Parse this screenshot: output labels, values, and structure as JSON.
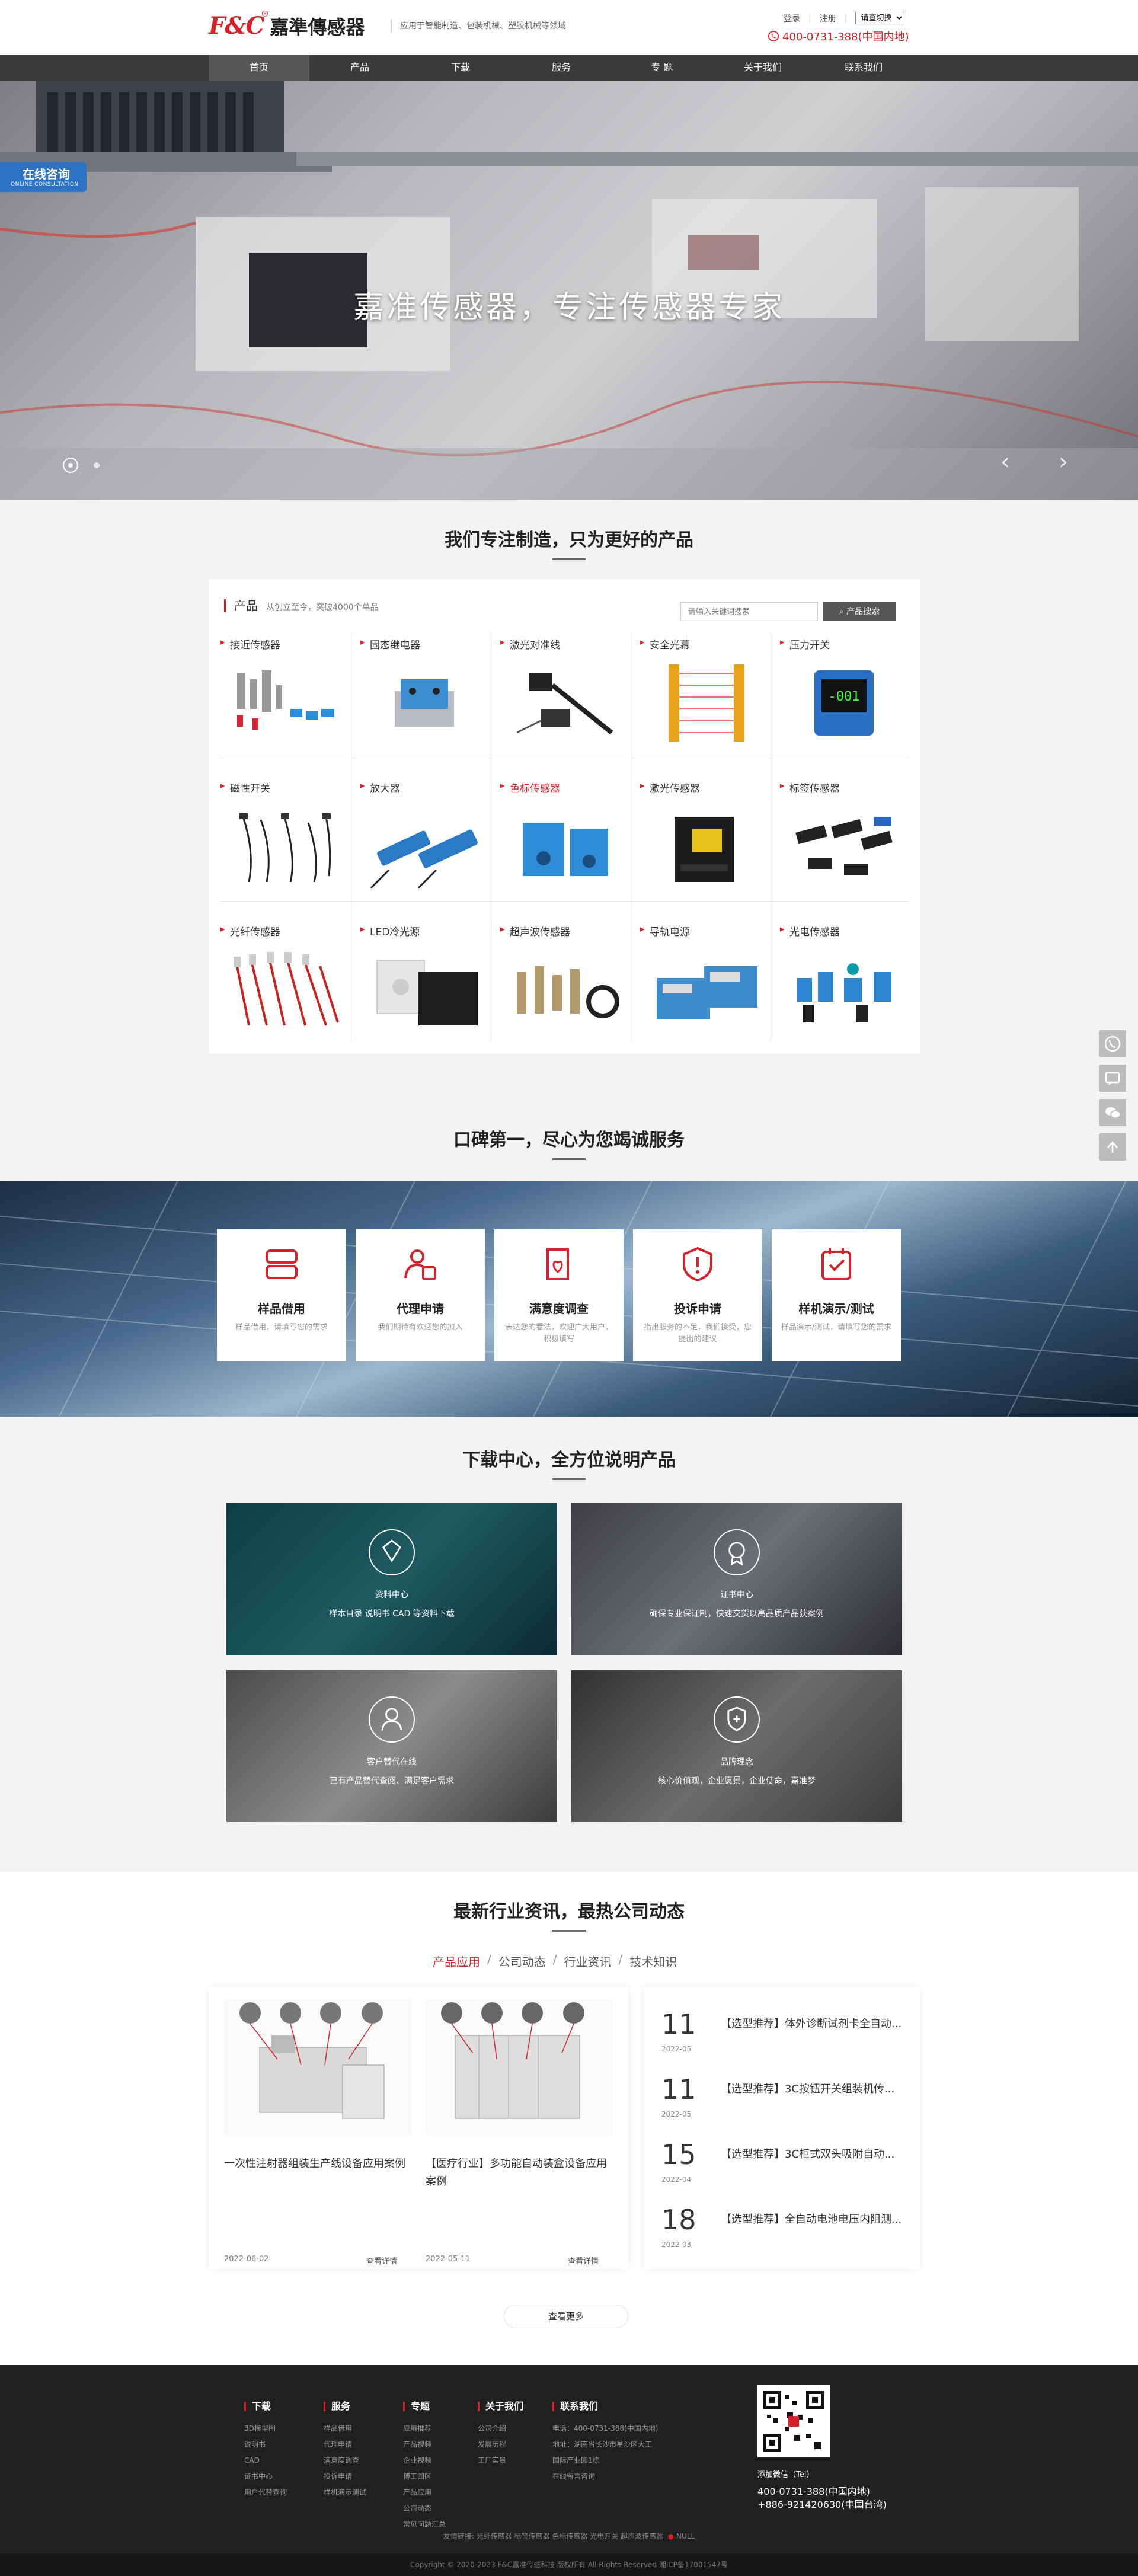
{
  "header": {
    "logo_fc": "F&C",
    "logo_reg": "®",
    "logo_cn": "嘉準傳感器",
    "slogan": "应用于智能制造、包装机械、塑胶机械等领域",
    "login": "登录",
    "register": "注册",
    "language": "请查切换",
    "phone": "400-0731-388(中国内地)"
  },
  "nav": {
    "items": [
      "首页",
      "产品",
      "下载",
      "服务",
      "专 题",
      "关于我们",
      "联系我们"
    ]
  },
  "hero": {
    "title": "嘉准传感器，专注传感器专家",
    "consult_title": "在线咨询",
    "consult_sub": "ONLINE CONSULTATION"
  },
  "products": {
    "section_title": "我们专注制造，只为更好的产品",
    "heading": "产品",
    "subheading": "从创立至今，突破4000个单品",
    "search_placeholder": "请输入关键词搜索",
    "search_button": "产品搜索",
    "items": [
      {
        "label": "接近传感器",
        "icon": "proximity-sensor-photo"
      },
      {
        "label": "固态继电器",
        "icon": "solid-state-relay-photo"
      },
      {
        "label": "激光对准线",
        "icon": "laser-alignment-photo"
      },
      {
        "label": "安全光幕",
        "icon": "safety-light-curtain-photo"
      },
      {
        "label": "压力开关",
        "icon": "pressure-switch-photo"
      },
      {
        "label": "磁性开关",
        "icon": "magnetic-switch-photo"
      },
      {
        "label": "放大器",
        "icon": "amplifier-photo"
      },
      {
        "label": "色标传感器",
        "icon": "color-mark-sensor-photo"
      },
      {
        "label": "激光传感器",
        "icon": "laser-sensor-photo"
      },
      {
        "label": "标签传感器",
        "icon": "label-sensor-photo"
      },
      {
        "label": "光纤传感器",
        "icon": "fiber-sensor-photo"
      },
      {
        "label": "LED冷光源",
        "icon": "led-light-source-photo"
      },
      {
        "label": "超声波传感器",
        "icon": "ultrasonic-sensor-photo"
      },
      {
        "label": "导轨电源",
        "icon": "din-rail-power-photo"
      },
      {
        "label": "光电传感器",
        "icon": "photoelectric-sensor-photo"
      }
    ]
  },
  "services": {
    "section_title": "口碑第一，尽心为您竭诚服务",
    "items": [
      {
        "name": "样品借用",
        "desc": "样品借用，请填写您的需求",
        "icon": "sample-icon"
      },
      {
        "name": "代理申请",
        "desc": "我们期待有欢迎您的加入",
        "icon": "agent-icon"
      },
      {
        "name": "满意度调查",
        "desc": "表达您的看法，欢迎广大用户，积极填写",
        "icon": "survey-icon"
      },
      {
        "name": "投诉申请",
        "desc": "指出服务的不足，我们接受，您提出的建议",
        "icon": "complaint-icon"
      },
      {
        "name": "样机演示/测试",
        "desc": "样品演示/测试，请填写您的需求",
        "icon": "demo-icon"
      }
    ]
  },
  "downloads": {
    "section_title": "下载中心，全方位说明产品",
    "items": [
      {
        "name": "资料中心",
        "desc": "样本目录 说明书 CAD 等资料下载",
        "icon": "diamond-icon"
      },
      {
        "name": "证书中心",
        "desc": "确保专业保证制，快速交货以高品质产品获案例",
        "icon": "certificate-icon"
      },
      {
        "name": "客户替代在线",
        "desc": "已有产品替代查阅、满足客户需求",
        "icon": "customer-icon"
      },
      {
        "name": "品牌理念",
        "desc": "核心价值观，企业愿景，企业使命，嘉准梦",
        "icon": "shield-icon"
      }
    ]
  },
  "news": {
    "section_title": "最新行业资讯，最热公司动态",
    "tabs": [
      "产品应用",
      "公司动态",
      "行业资讯",
      "技术知识"
    ],
    "cards": [
      {
        "title": "一次性注射器组装生产线设备应用案例",
        "date": "2022-06-02",
        "more": "查看详情"
      },
      {
        "title": "【医疗行业】多功能自动装盒设备应用案例",
        "date": "2022-05-11",
        "more": "查看详情"
      }
    ],
    "list": [
      {
        "day": "11",
        "ym": "2022-05",
        "title": "【选型推荐】体外诊断试剂卡全自动..."
      },
      {
        "day": "11",
        "ym": "2022-05",
        "title": "【选型推荐】3C按钮开关组装机传..."
      },
      {
        "day": "15",
        "ym": "2022-04",
        "title": "【选型推荐】3C柜式双头吸附自动..."
      },
      {
        "day": "18",
        "ym": "2022-03",
        "title": "【选型推荐】全自动电池电压内阻测..."
      }
    ],
    "more": "查看更多"
  },
  "footer": {
    "columns": [
      {
        "title": "下载",
        "links": [
          "3D模型图",
          "说明书",
          "CAD",
          "证书中心",
          "用户代替查询"
        ]
      },
      {
        "title": "服务",
        "links": [
          "样品借用",
          "代理申请",
          "满意度调查",
          "投诉申请",
          "样机演示测试"
        ]
      },
      {
        "title": "专题",
        "links": [
          "应用推荐",
          "产品视频",
          "企业视频",
          "博工园区",
          "产品应用",
          "公司动态",
          "常见问题汇总"
        ]
      },
      {
        "title": "关于我们",
        "links": [
          "公司介绍",
          "发展历程",
          "工厂实景"
        ]
      },
      {
        "title": "联系我们",
        "links": [
          "电话：400-0731-388(中国内地)",
          "地址：湖南省长沙市星沙区大工",
          "国际产业园1栋",
          "在线留言咨询"
        ]
      }
    ],
    "wechat": "添加微信（Tel）",
    "phone1": "400-0731-388(中国内地)",
    "phone2": "+886-921420630(中国台湾)",
    "links_line": "友情链接: 光纤传感器 标签传感器 色标传感器 光电开关 超声波传感器",
    "police": "NULL",
    "copyright": "Copyright © 2020-2023 F&C嘉准传感科技 版权所有 All Rights Reserved 湘ICP备17001547号"
  },
  "colors": {
    "brand": "#d7202a",
    "nav": "#3a3a3a",
    "footer": "#202020",
    "search_btn": "#555555"
  }
}
